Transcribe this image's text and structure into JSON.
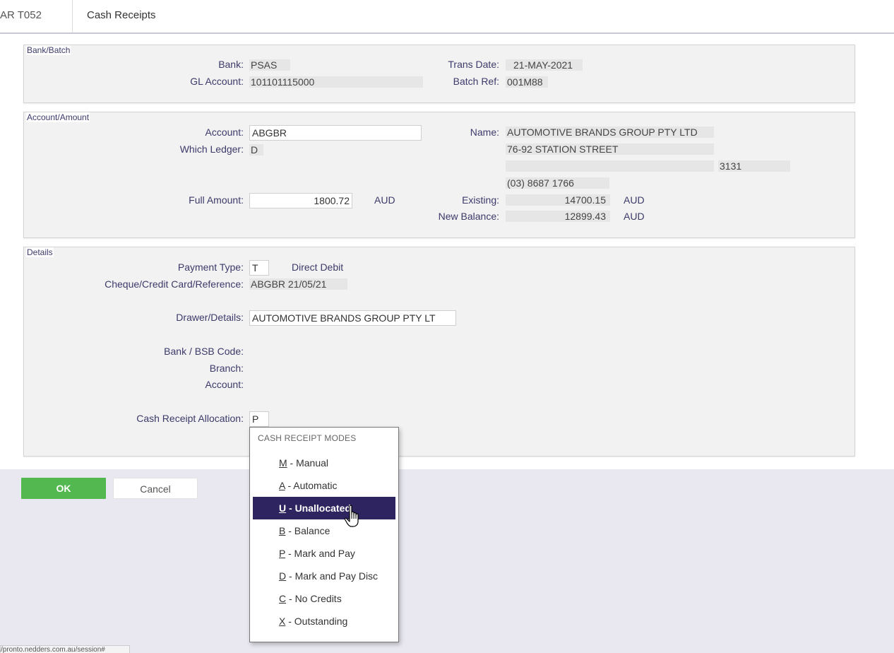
{
  "header": {
    "code": "AR T052",
    "title": "Cash Receipts"
  },
  "bank_batch": {
    "legend": "Bank/Batch",
    "bank_label": "Bank:",
    "bank_value": "PSAS",
    "gl_label": "GL Account:",
    "gl_value": "101101115000",
    "trans_date_label": "Trans Date:",
    "trans_date_value": "21-MAY-2021",
    "batch_ref_label": "Batch Ref:",
    "batch_ref_value": "001M88"
  },
  "account_amount": {
    "legend": "Account/Amount",
    "account_label": "Account:",
    "account_value": "ABGBR",
    "ledger_label": "Which Ledger:",
    "ledger_value": "D",
    "full_amount_label": "Full Amount:",
    "full_amount_value": "1800.72",
    "full_amount_currency": "AUD",
    "name_label": "Name:",
    "name_value": "AUTOMOTIVE BRANDS GROUP PTY LTD",
    "address1": "76-92 STATION STREET",
    "address2": "",
    "postcode": "3131",
    "phone": "(03) 8687 1766",
    "existing_label": "Existing:",
    "existing_value": "14700.15",
    "existing_currency": "AUD",
    "new_balance_label": "New Balance:",
    "new_balance_value": "12899.43",
    "new_balance_currency": "AUD"
  },
  "details": {
    "legend": "Details",
    "payment_type_label": "Payment Type:",
    "payment_type_value": "T",
    "payment_type_desc": "Direct Debit",
    "reference_label": "Cheque/Credit Card/Reference:",
    "reference_value": "ABGBR 21/05/21",
    "drawer_label": "Drawer/Details:",
    "drawer_value": "AUTOMOTIVE BRANDS GROUP PTY LT",
    "bsb_label": "Bank / BSB Code:",
    "branch_label": "Branch:",
    "account_label": "Account:",
    "allocation_label": "Cash Receipt Allocation:",
    "allocation_value": "P"
  },
  "buttons": {
    "ok": "OK",
    "cancel": "Cancel"
  },
  "dropdown": {
    "title": "CASH RECEIPT MODES",
    "selected_index": 2,
    "items": [
      {
        "key": "M",
        "label": " - Manual"
      },
      {
        "key": "A",
        "label": " - Automatic"
      },
      {
        "key": "U",
        "label": " - Unallocated"
      },
      {
        "key": "B",
        "label": " - Balance"
      },
      {
        "key": "P",
        "label": " - Mark and Pay"
      },
      {
        "key": "D",
        "label": " - Mark and Pay Disc"
      },
      {
        "key": "C",
        "label": " - No Credits"
      },
      {
        "key": "X",
        "label": " - Outstanding"
      }
    ]
  },
  "status_bar": {
    "url": "/pronto.nedders.com.au/session#"
  }
}
